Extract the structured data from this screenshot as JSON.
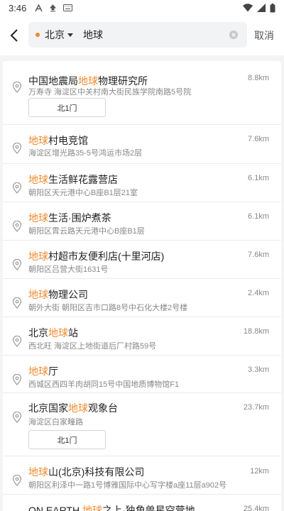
{
  "status_bar": {
    "time": "3:46",
    "left_icons": [
      "a-icon",
      "upload-icon",
      "keyboard-icon"
    ],
    "right_icons": [
      "wifi-icon",
      "signal-icon",
      "battery-icon"
    ]
  },
  "search": {
    "city": "北京",
    "query": "地球",
    "cancel_label": "取消"
  },
  "colors": {
    "highlight": "#f08a2c"
  },
  "results": [
    {
      "pre": "中国地震局",
      "hl": "地球",
      "post": "物理研究所",
      "address": "万寿寺  海淀区中关村南大街民族学院南路5号院",
      "distance": "8.8km",
      "gate": "北1门"
    },
    {
      "pre": "",
      "hl": "地球",
      "post": "村电竞馆",
      "address": "海淀区增光路35-5号鸿运市场2层",
      "distance": "7.6km"
    },
    {
      "pre": "",
      "hl": "地球",
      "post": "生活鲜花露营店",
      "address": "朝阳区天元港中心B座B1层21室",
      "distance": "6.1km"
    },
    {
      "pre": "",
      "hl": "地球",
      "post": "生活·围炉煮茶",
      "address": "朝阳区霄云路天元港中心B座B1层",
      "distance": "6.1km"
    },
    {
      "pre": "",
      "hl": "地球",
      "post": "村超市友便利店(十里河店)",
      "address": "朝阳区吕营大街1631号",
      "distance": "7.6km"
    },
    {
      "pre": "",
      "hl": "地球",
      "post": "物理公司",
      "address": "朝外大街  朝阳区吉市口路8号中石化大楼2号楼",
      "distance": "2.4km"
    },
    {
      "pre": "北京",
      "hl": "地球",
      "post": "站",
      "address": "西北旺  海淀区上地街道后厂村路59号",
      "distance": "18.8km"
    },
    {
      "pre": "",
      "hl": "地球",
      "post": "厅",
      "address": "西城区西四羊肉胡同15号中国地质博物馆F1",
      "distance": "3.3km"
    },
    {
      "pre": "北京国家",
      "hl": "地球",
      "post": "观象台",
      "address": "海淀区白家疃路",
      "distance": "23.7km",
      "gate": "北1门"
    },
    {
      "pre": "",
      "hl": "地球",
      "post": "山(北京)科技有限公司",
      "address": "朝阳区利泽中一路1号博雅国际中心写字楼a座11层a902号",
      "distance": "12km"
    },
    {
      "pre": "ON EARTH ",
      "hl": "地球",
      "post": "之上·独角兽星空营地",
      "address": "",
      "distance": "25.4km"
    }
  ]
}
